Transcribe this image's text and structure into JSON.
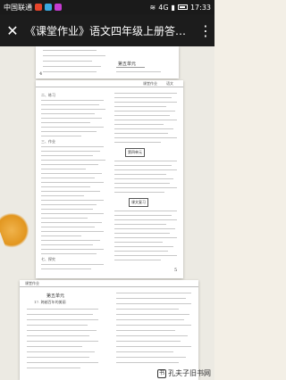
{
  "status_bar": {
    "carrier": "中国联通",
    "network": "4G",
    "time": "17:33"
  },
  "title_bar": {
    "close_glyph": "✕",
    "title": "《课堂作业》语文四年级上册答…",
    "more_glyph": "⋮"
  },
  "document": {
    "top_page": {
      "unit_label": "第五单元",
      "page_number": "4"
    },
    "main_page": {
      "header_label": "课堂作业",
      "grade_label": "语文",
      "sections": [
        "第四单元",
        "二、练习",
        "三、作业",
        "课文复习",
        "七、探究"
      ],
      "page_number": "5"
    },
    "bottom_page": {
      "header_label": "课堂作业",
      "unit_label": "第五单元",
      "lesson_title": "17. 跨越百年的美丽"
    }
  },
  "watermark": {
    "text": "孔夫子旧书网",
    "icon": "book-icon"
  }
}
